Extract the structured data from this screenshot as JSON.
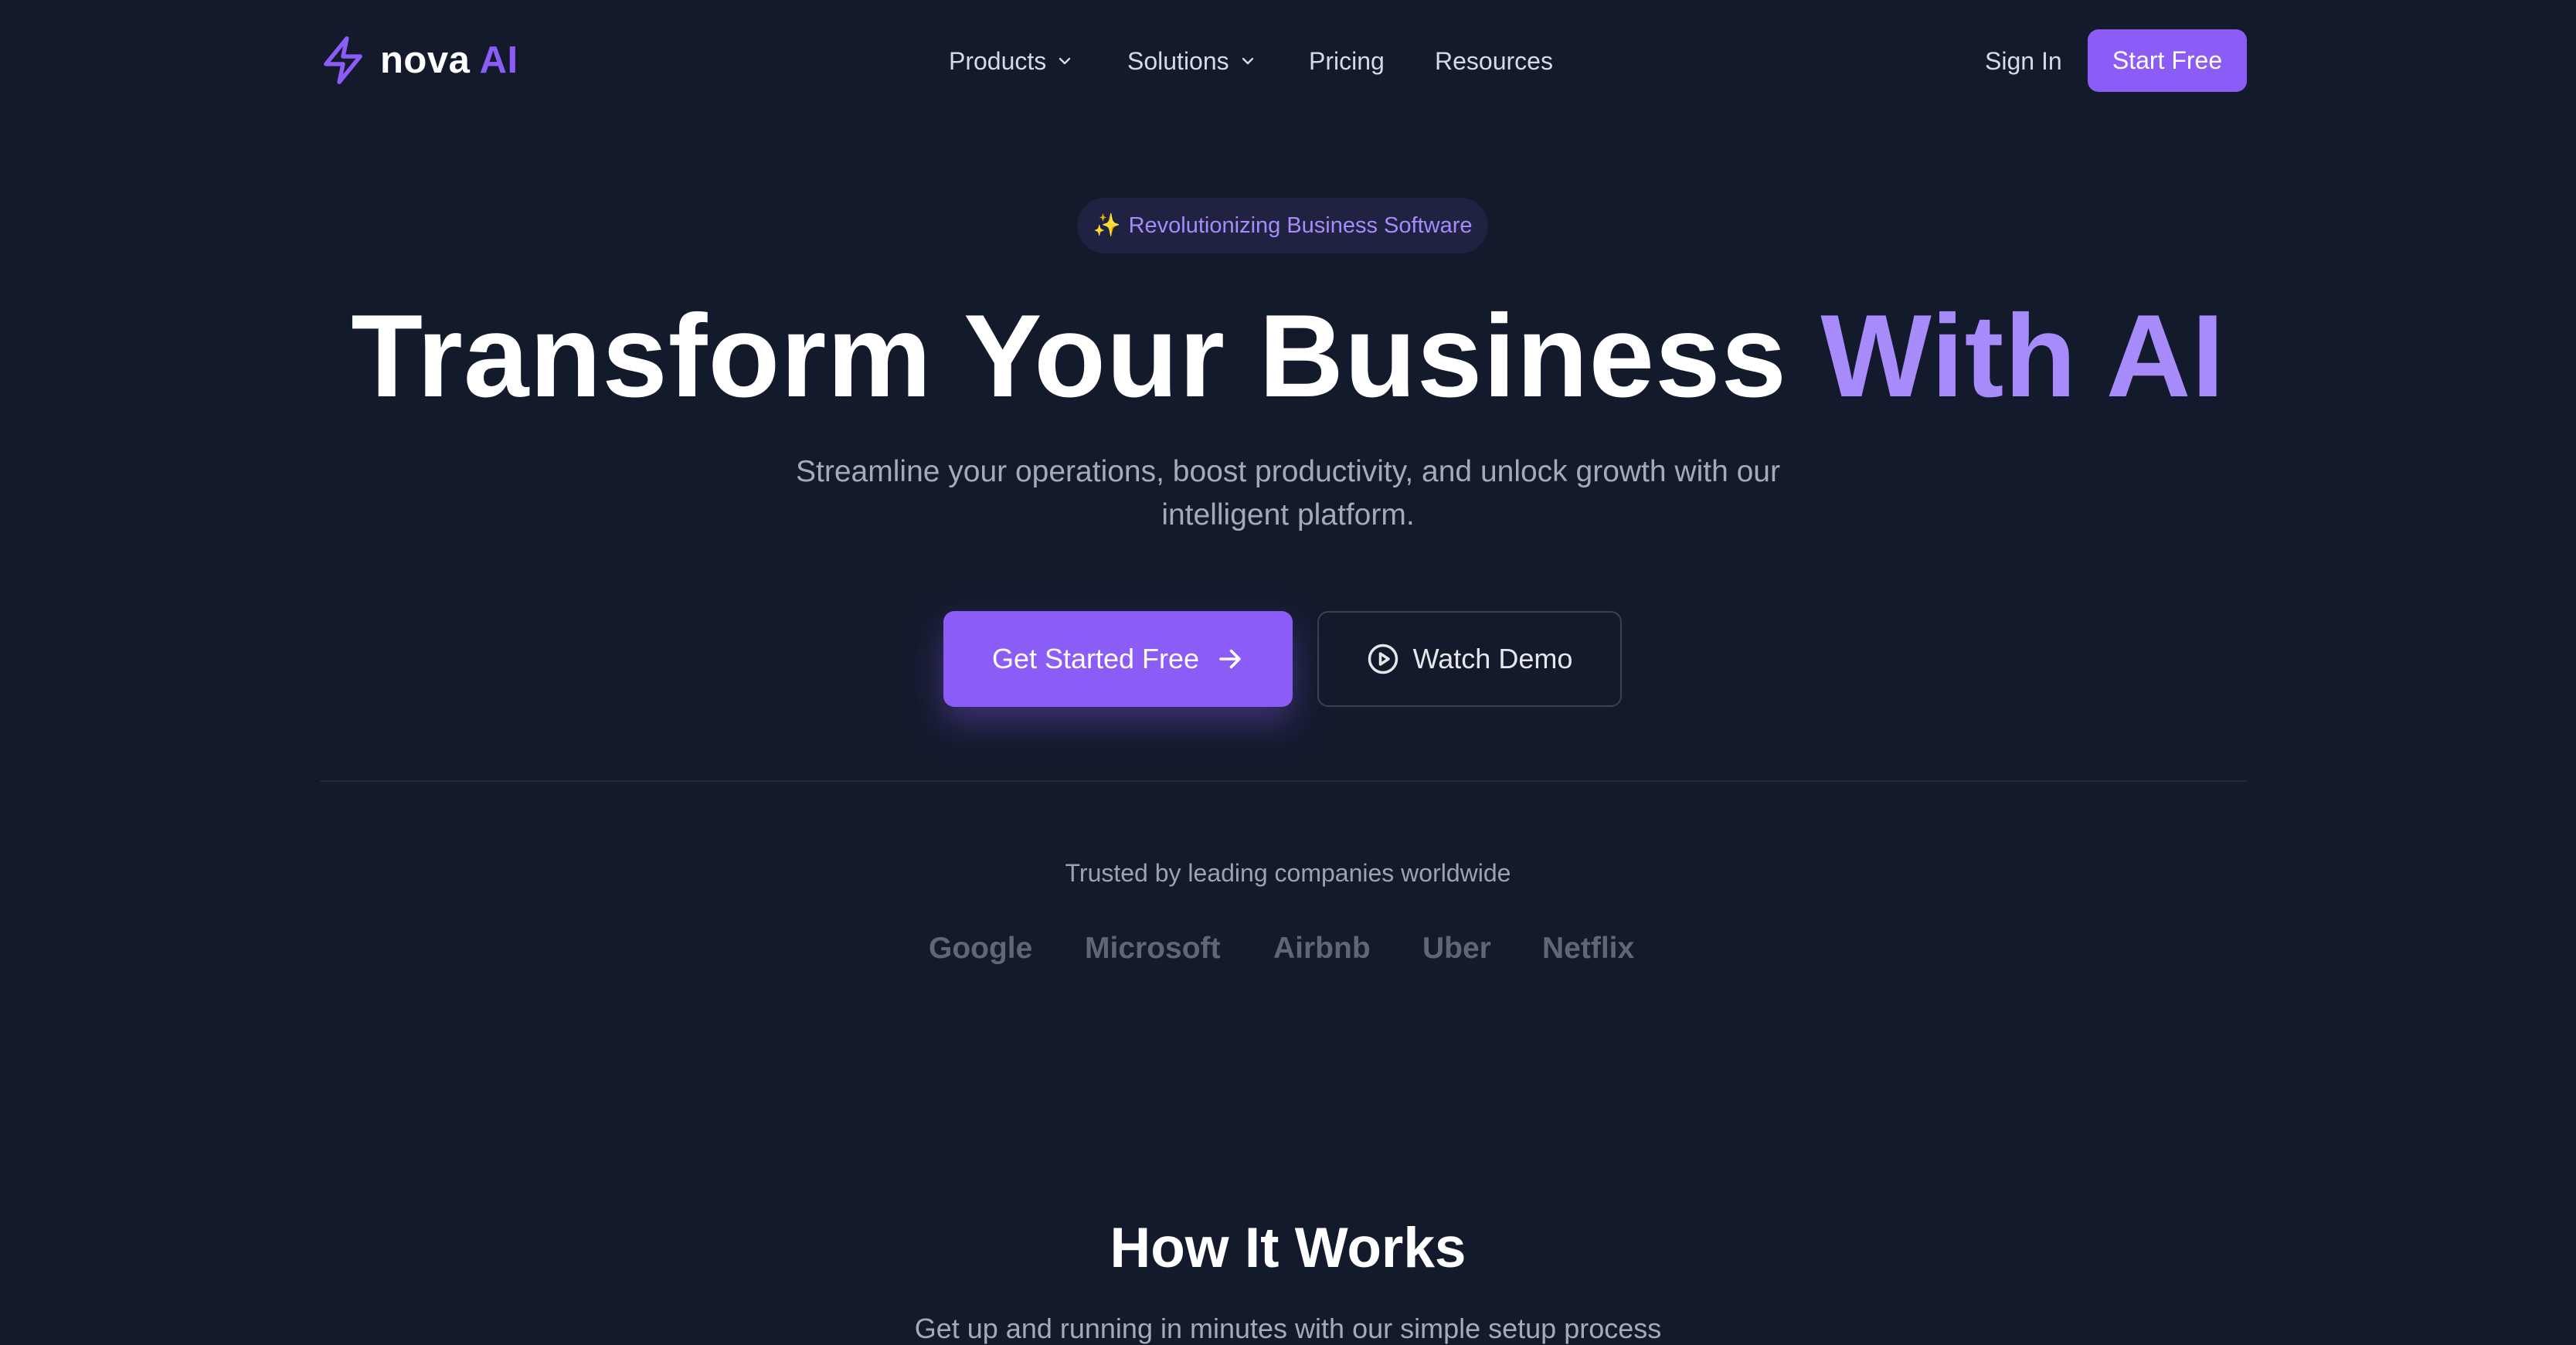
{
  "brand": {
    "name": "nova",
    "name_accent": "AI",
    "icon": "lightning-bolt-icon",
    "accent_color": "#8b5cf6"
  },
  "nav": {
    "items": [
      {
        "label": "Products",
        "has_dropdown": true
      },
      {
        "label": "Solutions",
        "has_dropdown": true
      },
      {
        "label": "Pricing",
        "has_dropdown": false
      },
      {
        "label": "Resources",
        "has_dropdown": false
      }
    ],
    "sign_in": "Sign In",
    "start_free": "Start Free"
  },
  "hero": {
    "badge_icon": "sparkles-icon",
    "badge_text": "Revolutionizing Business Software",
    "title": "Transform Your Business",
    "title_accent": "With AI",
    "subtitle": "Streamline your operations, boost productivity, and unlock growth with our intelligent platform.",
    "primary_cta": "Get Started Free",
    "secondary_cta": "Watch Demo"
  },
  "trusted": {
    "label": "Trusted by leading companies worldwide",
    "companies": [
      "Google",
      "Microsoft",
      "Airbnb",
      "Uber",
      "Netflix"
    ]
  },
  "how_it_works": {
    "title": "How It Works",
    "subtitle": "Get up and running in minutes with our simple setup process"
  },
  "colors": {
    "background": "#131a2c",
    "primary": "#8b5cf6",
    "accent_text": "#a78bfa",
    "muted_text": "#a3aab8"
  }
}
